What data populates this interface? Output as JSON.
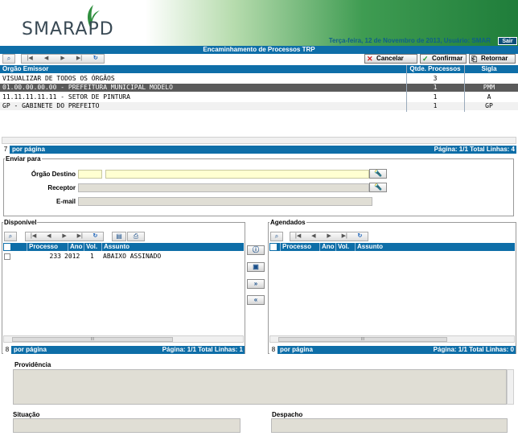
{
  "header": {
    "logo_text": "SMARAPD",
    "info": "Terça-feira, 12 de Novembro de 2013, Usuário: SMAR",
    "sair_label": "Sair"
  },
  "title": "Encaminhamento de Processos TRP",
  "toolbar": {
    "cancel_label": "Cancelar",
    "confirm_label": "Confirmar",
    "return_label": "Retornar"
  },
  "grid": {
    "columns": [
      "Orgão Emissor",
      "Qtde. Processos",
      "Sigla"
    ],
    "rows": [
      {
        "orgao": "VISUALIZAR DE TODOS OS ÓRGÃOS",
        "qtde": "3",
        "sigla": ""
      },
      {
        "orgao": "01.00.00.00.00 - PREFEITURA MUNICIPAL MODELO",
        "qtde": "1",
        "sigla": "PMM"
      },
      {
        "orgao": "11.11.11.11.11 - SETOR DE PINTURA",
        "qtde": "1",
        "sigla": "A"
      },
      {
        "orgao": "GP - GABINETE DO PREFEITO",
        "qtde": "1",
        "sigla": "GP"
      }
    ],
    "pager": {
      "per_page": "7",
      "label": "por página",
      "info": "Página: 1/1 Total Linhas: 4"
    }
  },
  "enviar": {
    "legend": "Enviar para",
    "orgao_label": "Órgão Destino",
    "receptor_label": "Receptor",
    "email_label": "E-mail"
  },
  "disponivel": {
    "legend": "Disponível",
    "columns": [
      "Processo",
      "Ano",
      "Vol.",
      "Assunto"
    ],
    "rows": [
      {
        "processo": "233",
        "ano": "2012",
        "vol": "1",
        "assunto": "ABAIXO ASSINADO"
      }
    ],
    "pager": {
      "per_page": "8",
      "label": "por página",
      "info": "Página: 1/1 Total Linhas: 1"
    }
  },
  "agendados": {
    "legend": "Agendados",
    "columns": [
      "Processo",
      "Ano",
      "Vol.",
      "Assunto"
    ],
    "pager": {
      "per_page": "8",
      "label": "por página",
      "info": "Página: 1/1 Total Linhas: 0"
    }
  },
  "providencia_label": "Providência",
  "situacao_label": "Situação",
  "despacho_label": "Despacho",
  "colors": {
    "accent": "#0e6ea8",
    "selected_row": "#5a5a5a",
    "brand_green": "#3f9c52"
  }
}
